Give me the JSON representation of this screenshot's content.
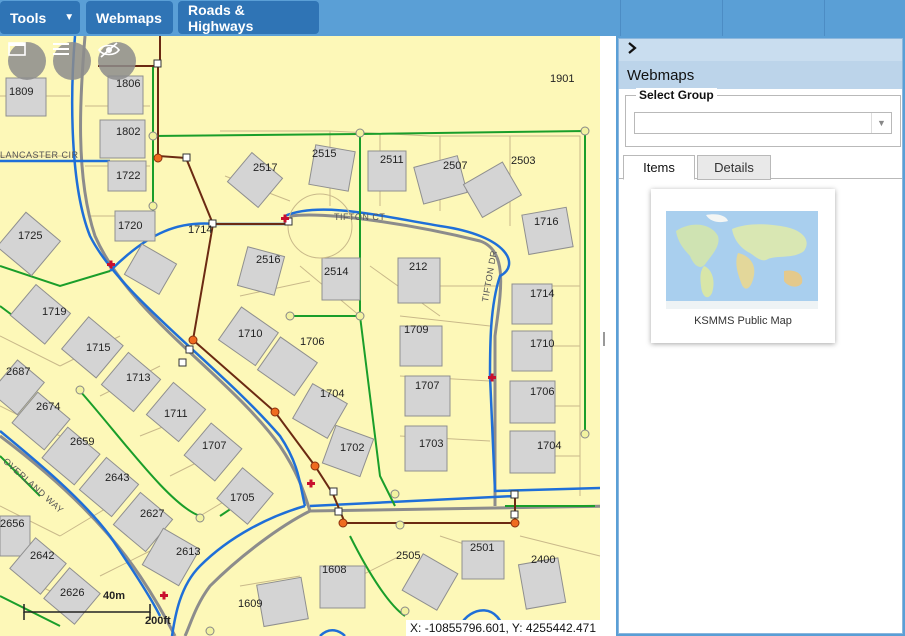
{
  "toolbar": {
    "tools_label": "Tools",
    "webmaps_label": "Webmaps",
    "roads_label": "Roads & Highways"
  },
  "map": {
    "coordinates": "X: -10855796.601, Y: 4255442.471",
    "scale_label_m": "40m",
    "scale_label_ft": "200ft",
    "icons": {
      "extent": "window-icon",
      "layers": "list-icon",
      "visibility": "eye-off-icon"
    },
    "street_labels": [
      "LANCASTER CIR",
      "TIFTON CT",
      "TIFTON DR",
      "OVERLAND WAY"
    ],
    "parcels": [
      {
        "id": "p1",
        "label": "1809"
      },
      {
        "id": "p2",
        "label": "1806"
      },
      {
        "id": "p3",
        "label": "1802"
      },
      {
        "id": "p4",
        "label": "1722"
      },
      {
        "id": "p5",
        "label": "1720"
      },
      {
        "id": "p6",
        "label": "1714"
      },
      {
        "id": "p7",
        "label": "1725"
      },
      {
        "id": "p8",
        "label": "1719"
      },
      {
        "id": "p9",
        "label": "1715"
      },
      {
        "id": "p10",
        "label": "1713"
      },
      {
        "id": "p11",
        "label": "1711"
      },
      {
        "id": "p12",
        "label": "1707"
      },
      {
        "id": "p13",
        "label": "1705"
      },
      {
        "id": "p14",
        "label": "1710"
      },
      {
        "id": "p15",
        "label": "1706"
      },
      {
        "id": "p16",
        "label": "1704"
      },
      {
        "id": "p17",
        "label": "1702"
      },
      {
        "id": "p18",
        "label": "2517"
      },
      {
        "id": "p19",
        "label": "2515"
      },
      {
        "id": "p20",
        "label": "2511"
      },
      {
        "id": "p21",
        "label": "2507"
      },
      {
        "id": "p22",
        "label": "2503"
      },
      {
        "id": "p23",
        "label": "2516"
      },
      {
        "id": "p24",
        "label": "2514"
      },
      {
        "id": "p25",
        "label": "212"
      },
      {
        "id": "p26",
        "label": "1709"
      },
      {
        "id": "p27",
        "label": "1707"
      },
      {
        "id": "p28",
        "label": "1703"
      },
      {
        "id": "p29",
        "label": "1716"
      },
      {
        "id": "p30",
        "label": "1714"
      },
      {
        "id": "p31",
        "label": "1710"
      },
      {
        "id": "p32",
        "label": "1706"
      },
      {
        "id": "p33",
        "label": "1704"
      },
      {
        "id": "p34",
        "label": "1901"
      },
      {
        "id": "p35",
        "label": "2687"
      },
      {
        "id": "p36",
        "label": "2674"
      },
      {
        "id": "p37",
        "label": "2659"
      },
      {
        "id": "p38",
        "label": "2643"
      },
      {
        "id": "p39",
        "label": "2627"
      },
      {
        "id": "p40",
        "label": "2613"
      },
      {
        "id": "p41",
        "label": "2656"
      },
      {
        "id": "p42",
        "label": "2642"
      },
      {
        "id": "p43",
        "label": "2626"
      },
      {
        "id": "p44",
        "label": "1608"
      },
      {
        "id": "p45",
        "label": "1609"
      },
      {
        "id": "p46",
        "label": "2505"
      },
      {
        "id": "p47",
        "label": "2501"
      },
      {
        "id": "p48",
        "label": "2400"
      }
    ]
  },
  "panel": {
    "title": "Webmaps",
    "collapse_icon": "chevron-right-icon",
    "group_legend": "Select Group",
    "group_value": "",
    "tabs": [
      {
        "label": "Items",
        "active": true
      },
      {
        "label": "Details",
        "active": false
      }
    ],
    "items": [
      {
        "label": "KSMMS Public Map",
        "thumbnail": "world-map-thumbnail"
      }
    ]
  },
  "colors": {
    "toolbar": "#5a9fd6",
    "button": "#2f74b5",
    "map_bg": "#fdf8b8",
    "water_line": "#1f6fd8",
    "sewer_line": "#1a9e2a",
    "pipe_line": "#6b2a12",
    "building": "#d4d4d4"
  }
}
